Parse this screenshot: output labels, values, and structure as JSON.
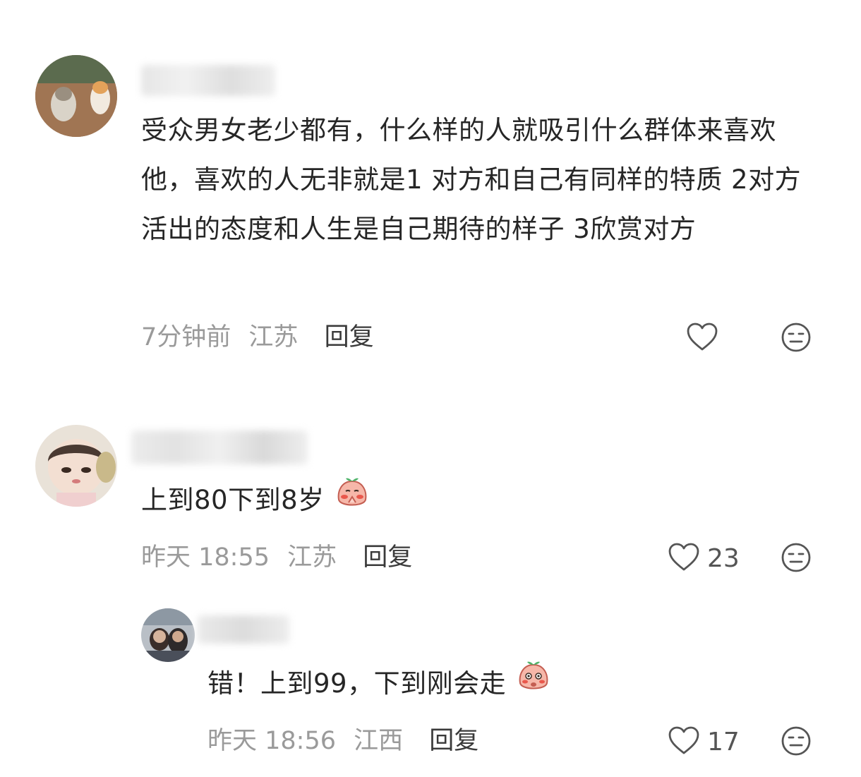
{
  "comments": [
    {
      "text": "受众男女老少都有，什么样的人就吸引什么群体来喜欢他，喜欢的人无非就是1 对方和自己有同样的特质  2对方活出的态度和人生是自己期待的样子 3欣赏对方",
      "time": "7分钟前",
      "location": "江苏",
      "reply_label": "回复",
      "like_count": ""
    },
    {
      "text": "上到80下到8岁",
      "time": "昨天 18:55",
      "location": "江苏",
      "reply_label": "回复",
      "like_count": "23"
    },
    {
      "text": "错！上到99，下到刚会走",
      "time": "昨天 18:56",
      "location": "江西",
      "reply_label": "回复",
      "like_count": "17"
    }
  ],
  "icons": {
    "like": "heart-outline-icon",
    "dislike": "meh-face-icon",
    "emoji_1": "peach-pray-emoji",
    "emoji_2": "peach-shy-emoji"
  },
  "colors": {
    "text": "#262626",
    "meta": "#9a9a9a",
    "reply": "#3a3a3a",
    "icon": "#555555"
  }
}
